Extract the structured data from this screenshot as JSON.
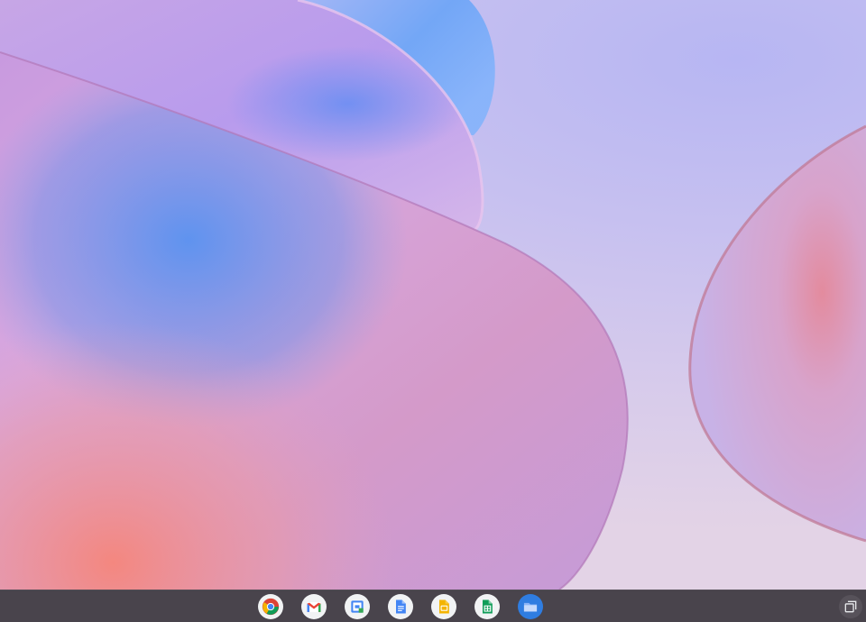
{
  "shelf": {
    "apps": [
      {
        "name": "chrome-icon"
      },
      {
        "name": "gmail-icon"
      },
      {
        "name": "calendar-icon"
      },
      {
        "name": "docs-icon"
      },
      {
        "name": "slides-icon"
      },
      {
        "name": "sheets-icon"
      },
      {
        "name": "files-icon"
      }
    ],
    "overview_icon": "window-overview-icon"
  },
  "colors": {
    "shelf_bg": "#3e3a3e",
    "wallpaper_sky": "#c6c0f0",
    "wallpaper_blue": "#6aa4f7",
    "wallpaper_pink": "#dba2d8",
    "wallpaper_coral": "#f08c8c"
  }
}
